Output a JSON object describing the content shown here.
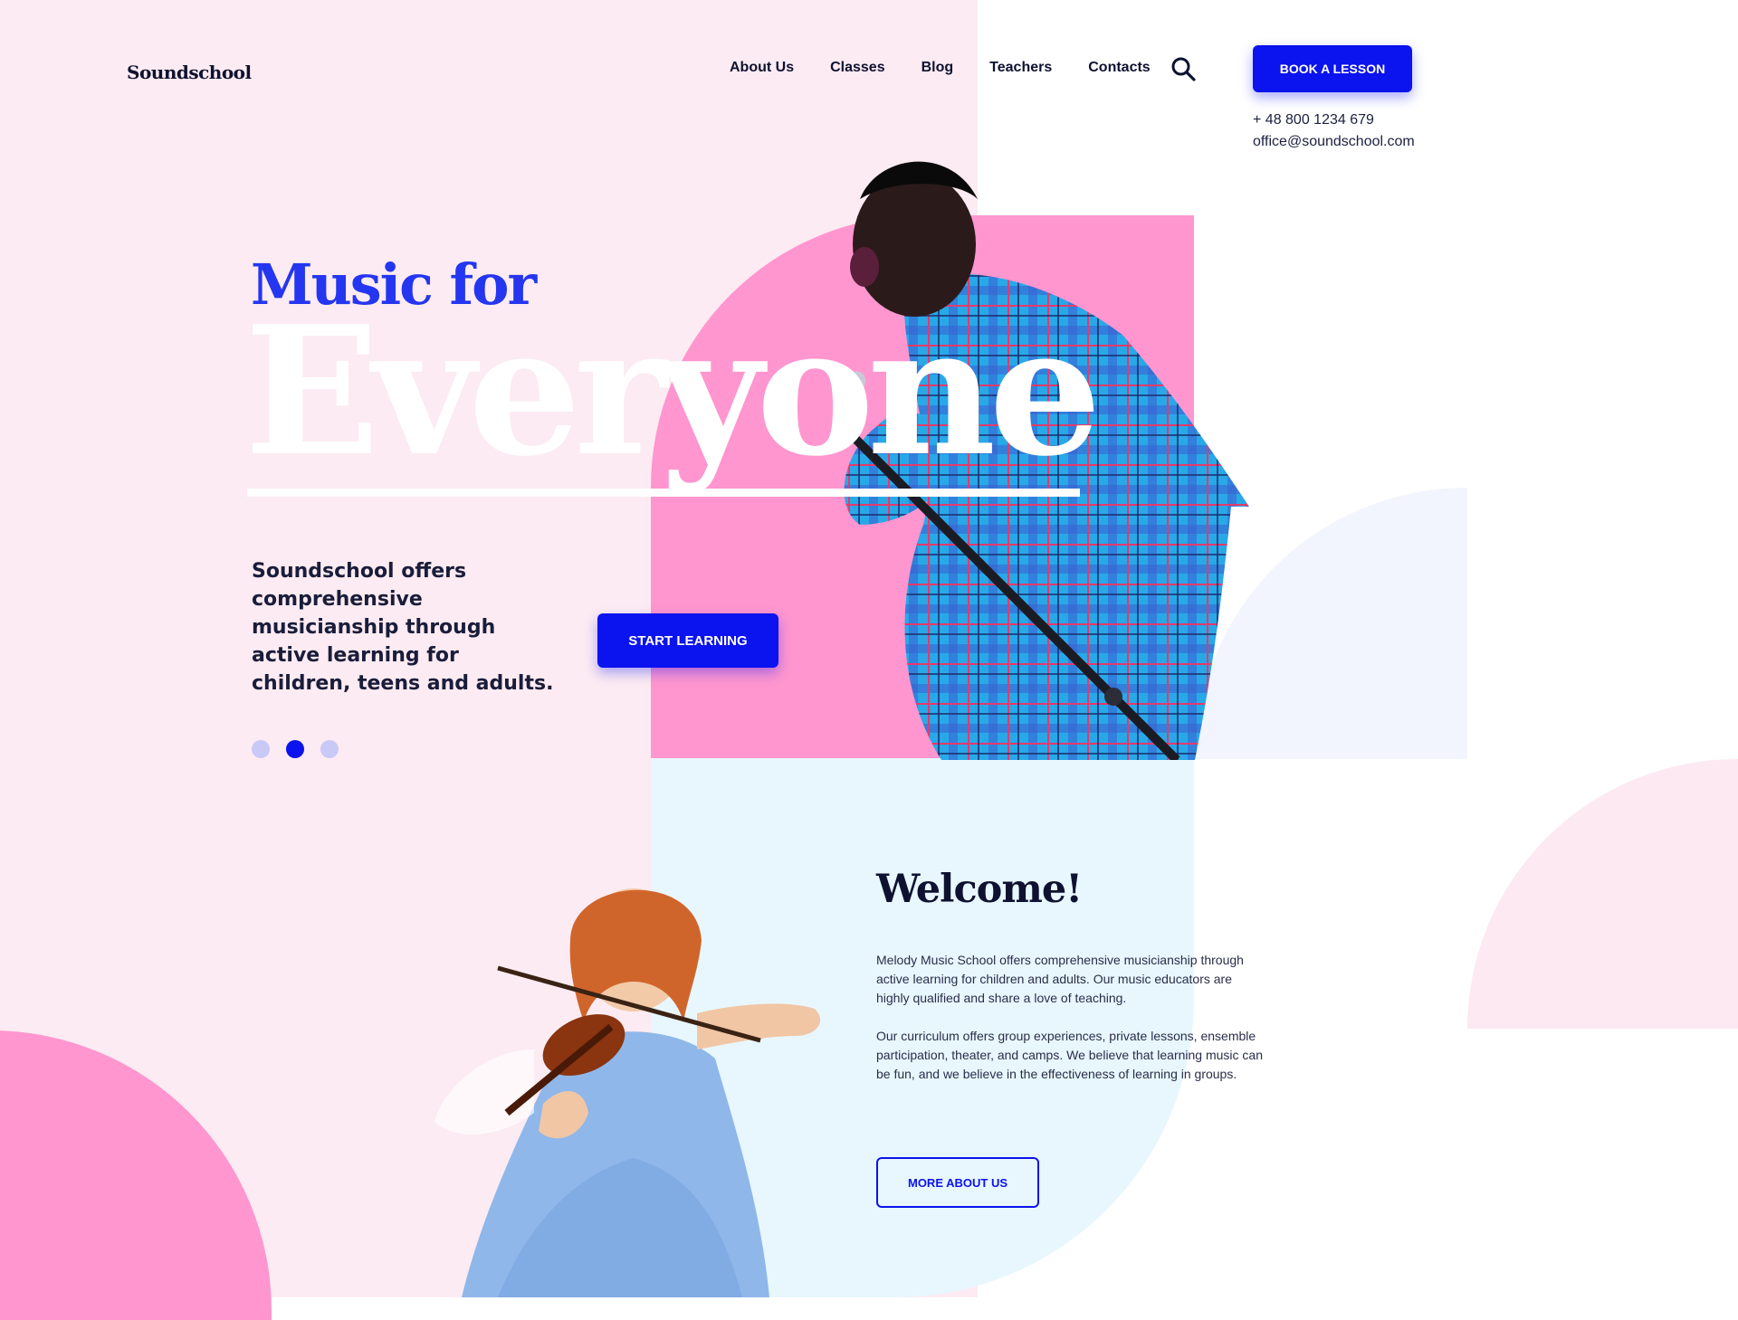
{
  "header": {
    "logo": "Soundschool",
    "nav": [
      "About Us",
      "Classes",
      "Blog",
      "Teachers",
      "Contacts"
    ],
    "book_label": "BOOK A LESSON",
    "phone": "+ 48 800 1234 679",
    "email": "office@soundschool.com",
    "search_icon": "search-icon"
  },
  "hero": {
    "title_small": "Music for",
    "title_large": "Everyone",
    "description": "Soundschool  offers comprehensive musicianship through active learning for children, teens and adults.",
    "start_label": "START LEARNING",
    "slides": {
      "count": 3,
      "active": 2
    }
  },
  "welcome": {
    "title": "Welcome!",
    "p1": "Melody Music School offers comprehensive musicianship through active learning for children and adults. Our music educators are highly qualified and share a love of teaching.",
    "p2": "Our curriculum offers group experiences, private lessons, ensemble participation, theater, and camps. We believe that learning music can be fun, and we believe in the effectiveness of learning in groups.",
    "more_label": "MORE ABOUT US"
  },
  "colors": {
    "accent": "#0b13ee",
    "heading_blue": "#2536f0",
    "pink": "#ff96cf",
    "pale_pink": "#fcebf2",
    "pale_cyan": "#e8f7fe"
  }
}
